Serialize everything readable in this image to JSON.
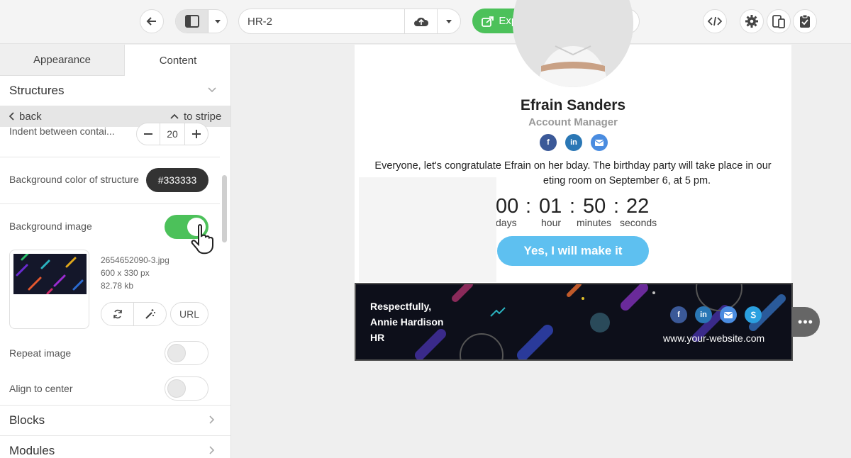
{
  "toolbar": {
    "template_name": "HR-2",
    "export_label": "Export"
  },
  "panel": {
    "tabs": [
      "Appearance",
      "Content"
    ],
    "structures_label": "Structures",
    "back_label": "back",
    "to_stripe_label": "to stripe",
    "indent_label": "Indent between contai...",
    "indent_value": "20",
    "bg_color_label": "Background color of structure",
    "bg_color_value": "#333333",
    "bg_image_label": "Background image",
    "bg_image_enabled": true,
    "file_name": "2654652090-3.jpg",
    "file_dims": "600 x 330 px",
    "file_size": "82.78 kb",
    "url_label": "URL",
    "repeat_label": "Repeat image",
    "align_label": "Align to center",
    "blocks_label": "Blocks",
    "modules_label": "Modules"
  },
  "email": {
    "name": "Efrain Sanders",
    "role": "Account Manager",
    "message_line1": "Everyone, let's congratulate Efrain on her bday. The birthday party will take place in our",
    "message_line2": "eting room on September 6, at 5 pm.",
    "countdown": {
      "days": "00",
      "hours": "01",
      "minutes": "50",
      "seconds": "22",
      "days_label": "days",
      "hours_label": "hour",
      "minutes_label": "minutes",
      "seconds_label": "seconds",
      "separator": ":"
    },
    "rsvp_label": "Yes, I will make it",
    "footer": {
      "line1": "Respectfully,",
      "line2": "Annie Hardison",
      "line3": "HR",
      "website": "www.your-website.com"
    }
  },
  "icons": {
    "facebook": "f",
    "linkedin": "in",
    "more": "•••"
  }
}
